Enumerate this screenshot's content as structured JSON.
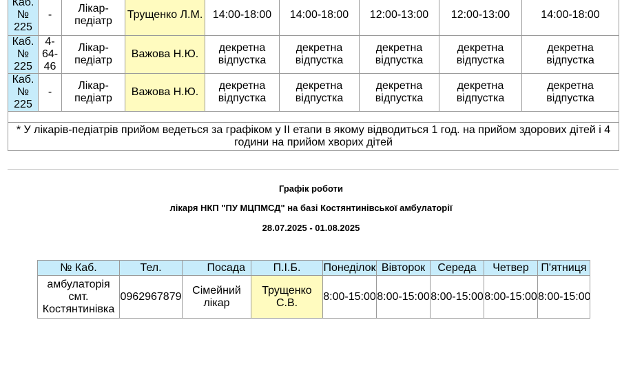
{
  "top_schedule": {
    "rows": [
      {
        "cabinet": "Каб. № 225",
        "phone": "-",
        "position": "Лікар-педіатр",
        "name": "Трущенко Л.М.",
        "days": [
          "14:00-18:00",
          "14:00-18:00",
          "12:00-13:00",
          "12:00-13:00",
          "14:00-18:00"
        ]
      },
      {
        "cabinet": "Каб. № 225",
        "phone": "4-64-46",
        "position": "Лікар-педіатр",
        "name": "Важова Н.Ю.",
        "days": [
          "декретна відпустка",
          "декретна відпустка",
          "декретна відпустка",
          "декретна відпустка",
          "декретна відпустка"
        ]
      },
      {
        "cabinet": "Каб. № 225",
        "phone": "-",
        "position": "Лікар-педіатр",
        "name": "Важова Н.Ю.",
        "days": [
          "декретна відпустка",
          "декретна відпустка",
          "декретна відпустка",
          "декретна відпустка",
          "декретна відпустка"
        ]
      }
    ],
    "footnote": "* У лікарів-педіатрів прийом ведеться за графіком у ІІ етапи  в якому відводиться  1 год. на прийом здорових дітей і 4 години на прийом хворих дітей"
  },
  "heading": {
    "line1": "Графік роботи",
    "line2": "лікаря НКП \"ПУ МЦПМСД\" на базі Костянтинівської амбулаторії",
    "line3": "28.07.2025 - 01.08.2025"
  },
  "bottom_schedule": {
    "headers": [
      "№ Каб.",
      "Тел.",
      "Посада",
      "П.І.Б.",
      "Понеділок",
      "Вівторок",
      "Середа",
      "Четвер",
      "П'ятниця"
    ],
    "row": {
      "cabinet": "амбулаторія смт. Костянтинівка",
      "phone": "0962967879",
      "position": "Сімейний лікар",
      "name": "Трущенко С.В.",
      "days": [
        "8:00-15:00",
        "8:00-15:00",
        "8:00-15:00",
        "8:00-15:00",
        "8:00-15:00"
      ]
    }
  }
}
